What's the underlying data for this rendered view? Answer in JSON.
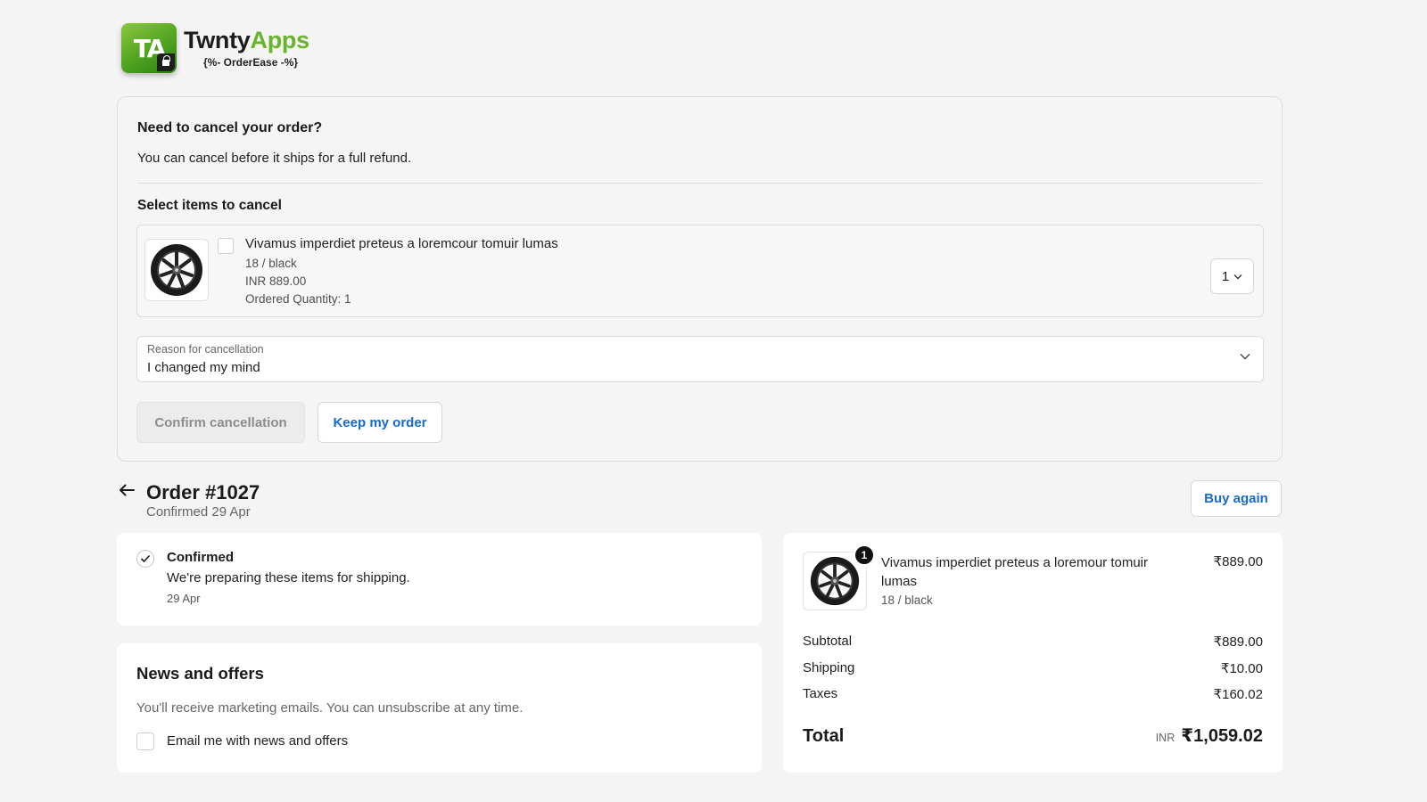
{
  "brand": {
    "logo_initials": "TA",
    "name_part1": "Twnty",
    "name_part2": "Apps",
    "tagline": "{%- OrderEase -%}",
    "colors": {
      "green": "#69b42a",
      "dark": "#1c1c1c"
    }
  },
  "cancel": {
    "title": "Need to cancel your order?",
    "subtitle": "You can cancel before it ships for a full refund.",
    "select_label": "Select items to cancel",
    "item": {
      "icon": "wheel-image",
      "title": "Vivamus imperdiet preteus a loremcour tomuir lumas",
      "variant": "18 / black",
      "price": "INR 889.00",
      "ordered_quantity": "Ordered Quantity: 1",
      "checked": false,
      "quantity_selected": "1"
    },
    "reason": {
      "label": "Reason for cancellation",
      "value": "I changed my mind"
    },
    "confirm_label": "Confirm cancellation",
    "keep_label": "Keep my order"
  },
  "order": {
    "title": "Order #1027",
    "subtitle": "Confirmed 29 Apr",
    "buy_again_label": "Buy again"
  },
  "status": {
    "title": "Confirmed",
    "description": "We're preparing these items for shipping.",
    "date": "29 Apr"
  },
  "news": {
    "title": "News and offers",
    "description": "You'll receive marketing emails. You can unsubscribe at any time.",
    "checkbox_label": "Email me with news and offers",
    "checked": false
  },
  "summary": {
    "item": {
      "quantity_badge": "1",
      "title": "Vivamus imperdiet preteus a loremour tomuir lumas",
      "variant": "18 / black",
      "price": "₹889.00"
    },
    "subtotal_label": "Subtotal",
    "subtotal_value": "₹889.00",
    "shipping_label": "Shipping",
    "shipping_value": "₹10.00",
    "taxes_label": "Taxes",
    "taxes_value": "₹160.02",
    "total_label": "Total",
    "total_currency": "INR",
    "total_value": "₹1,059.02"
  },
  "colors": {
    "link_blue": "#1669d3",
    "page_bg": "#f4f4f4",
    "disabled_text": "#8d8d8d"
  }
}
